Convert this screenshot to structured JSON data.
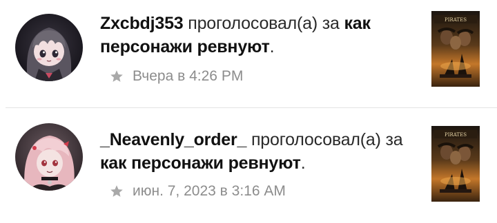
{
  "feed": {
    "items": [
      {
        "username": "Zxcbdj353",
        "action": "проголосовал(а) за",
        "poll_title": "как персонажи ревнуют",
        "punctuation": ".",
        "timestamp": "Вчера в 4:26 PM",
        "avatar_icon": "anime-girl-dark-hair-avatar",
        "poster_icon": "pirates-of-the-caribbean-poster"
      },
      {
        "username": "_Neavenly_order_",
        "action": "проголосовал(а) за",
        "poll_title": "как персонажи ревнуют",
        "punctuation": ".",
        "timestamp": "июн. 7, 2023 в 3:16 AM",
        "avatar_icon": "anime-girl-pink-hair-avatar",
        "poster_icon": "pirates-of-the-caribbean-poster"
      }
    ]
  },
  "colors": {
    "text_primary": "#111111",
    "text_secondary": "#8c8c8c",
    "divider": "#e3e3e3",
    "star_icon": "#a9a9a9"
  }
}
